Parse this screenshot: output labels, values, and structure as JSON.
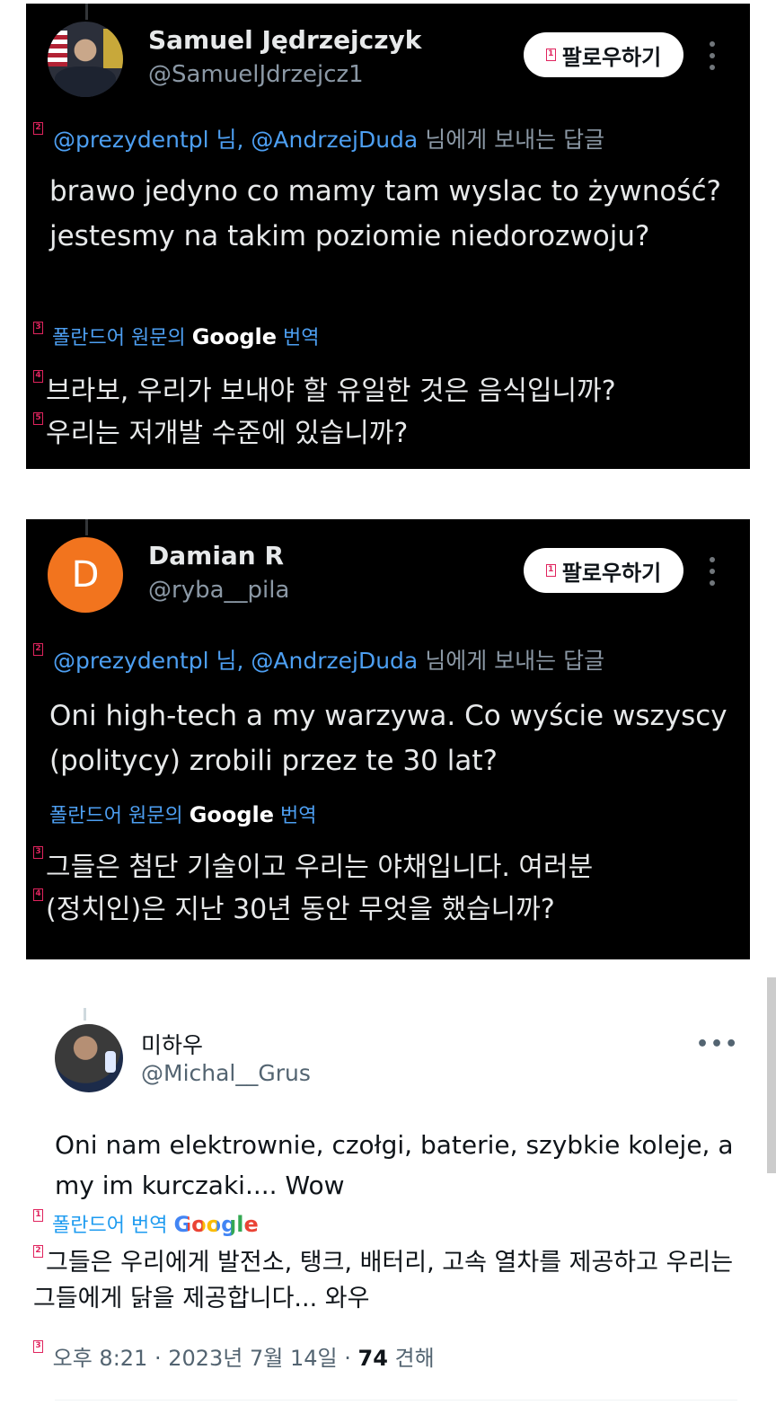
{
  "tweets": [
    {
      "display_name": "Samuel Jędrzejczyk",
      "handle": "@SamuelJdrzejcz1",
      "follow_label": "팔로우하기",
      "reply_mentions": "@prezydentpl 님, @AndrzejDuda",
      "reply_suffix": "님에게 보내는 답글",
      "text": "brawo jedyno co mamy tam wyslac to żywność?  jestesmy na takim poziomie niedorozwoju?",
      "translate_prefix": "폴란드어 원문의",
      "translate_google": "Google",
      "translate_suffix": "번역",
      "translation_line1": "브라보, 우리가 보내야 할 유일한 것은 음식입니까?",
      "translation_line2": "우리는 저개발 수준에 있습니까?"
    },
    {
      "display_name": "Damian R",
      "avatar_letter": "D",
      "handle": "@ryba__pila",
      "follow_label": "팔로우하기",
      "reply_mentions": "@prezydentpl 님, @AndrzejDuda",
      "reply_suffix": "님에게 보내는 답글",
      "text": "Oni high-tech a my warzywa. Co wyście wszyscy (politycy) zrobili przez te 30 lat?",
      "translate_prefix": "폴란드어 원문의",
      "translate_google": "Google",
      "translate_suffix": "번역",
      "translation_line1": "그들은 첨단 기술이고 우리는 야채입니다. 여러분",
      "translation_line2": "(정치인)은 지난 30년 동안 무엇을 했습니까?"
    },
    {
      "display_name": "미하우",
      "handle": "@Michal__Grus",
      "more_label": "•••",
      "text": "Oni nam elektrownie, czołgi, baterie, szybkie koleje, a my im kurczaki.... Wow",
      "translate_label": "폴란드어 번역",
      "translate_google": "Google",
      "translation": "그들은 우리에게 발전소, 탱크, 배터리, 고속 열차를 제공하고 우리는 그들에게 닭을 제공합니다... 와우",
      "time": "오후 8:21 · 2023년 7월 14일 ·",
      "views_count": "74",
      "views_label": "견해"
    }
  ],
  "markers": [
    "1",
    "2",
    "3",
    "4",
    "5"
  ],
  "colors": {
    "dark_bg": "#000000",
    "link_blue": "#4d9ff2",
    "follow_bg": "#ffffff",
    "damian_avatar": "#f2741e"
  }
}
